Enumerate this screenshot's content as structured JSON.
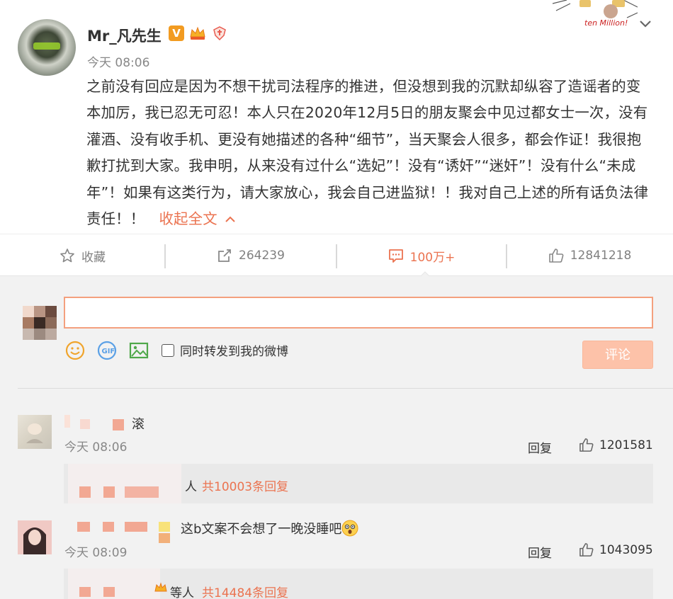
{
  "post": {
    "author": "Mr_凡先生",
    "verified_badge": "V",
    "time": "今天 08:06",
    "body": "之前没有回应是因为不想干扰司法程序的推进，但没想到我的沉默却纵容了造谣者的变本加厉，我已忍无可忍！本人只在2020年12月5日的朋友聚会中见过都女士一次，没有灌酒、没有收手机、更没有她描述的各种“细节”，当天聚会人很多，都会作证！我很抱歉打扰到大家。我申明，从来没有过什么“选妃”！没有“诱奸”“迷奸”！没有什么“未成年”！如果有这类行为，请大家放心，我会自己进监狱！！我对自己上述的所有话负法律责任！！",
    "collapse_label": "收起全文",
    "corner_decoration_text": "ten Million!"
  },
  "actions": {
    "favorite_label": "收藏",
    "repost_count": "264239",
    "comment_count": "100万+",
    "like_count": "12841218"
  },
  "composer": {
    "input_value": "",
    "also_repost_label": "同时转发到我的微博",
    "submit_label": "评论"
  },
  "comments": [
    {
      "text": "滚",
      "time": "今天 08:06",
      "reply_label": "回复",
      "likes": "1201581",
      "sub_people": "人",
      "sub_count": "共10003条回复"
    },
    {
      "text": "这b文案不会想了一晚没睡吧",
      "time": "今天 08:09",
      "reply_label": "回复",
      "likes": "1043095",
      "sub_people": "等人",
      "sub_count": "共14484条回复"
    }
  ],
  "colors": {
    "accent": "#eb7350",
    "muted": "#888888",
    "submit_disabled": "#fdc2a9"
  },
  "icons": [
    "star-icon",
    "repost-icon",
    "comment-icon",
    "like-icon",
    "emoji-icon",
    "gif-icon",
    "image-icon",
    "chevron-down-icon",
    "chevron-up-icon"
  ]
}
